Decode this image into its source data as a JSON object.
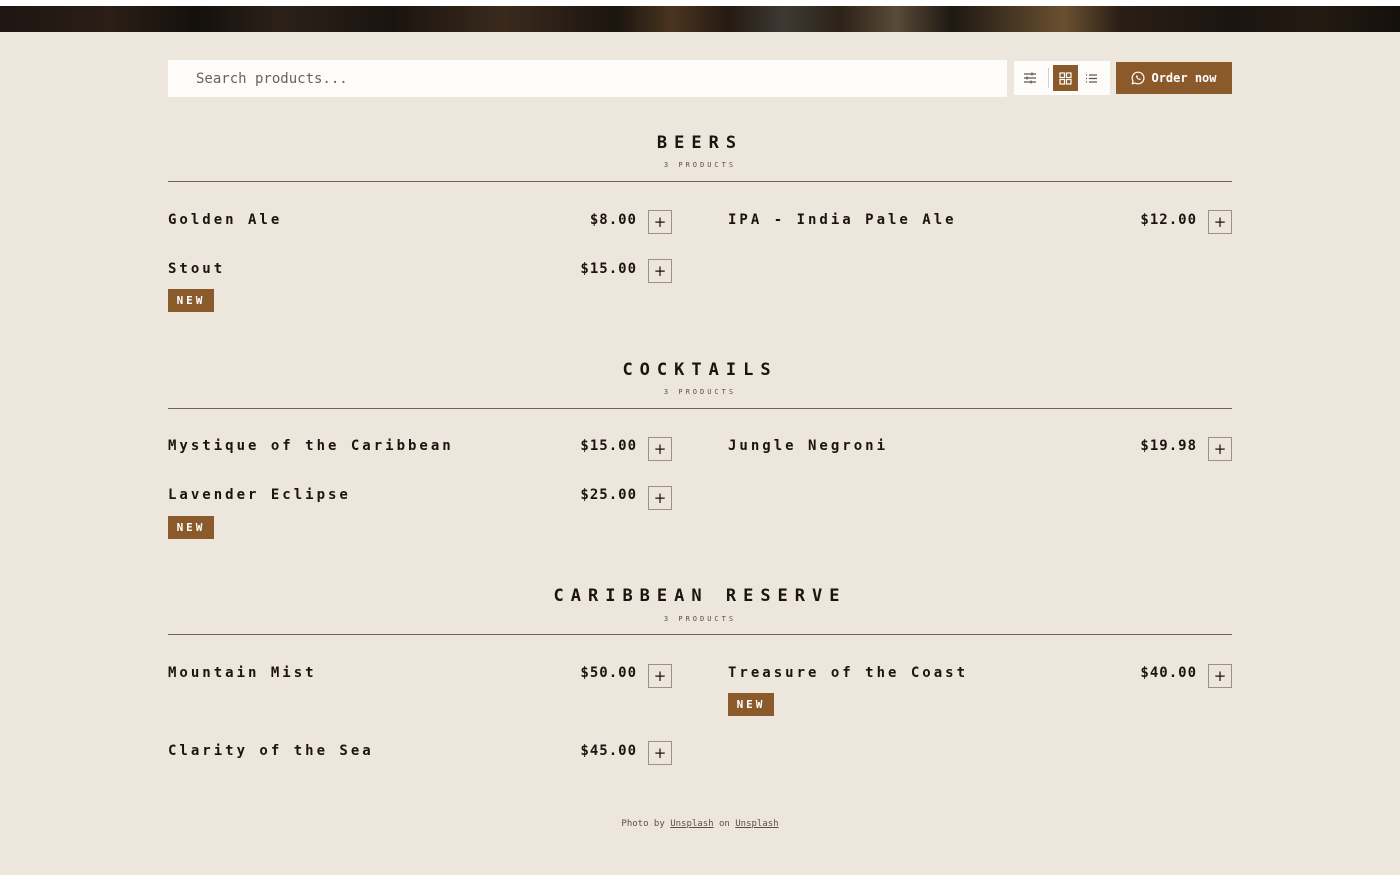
{
  "search": {
    "placeholder": "Search products..."
  },
  "toolbar": {
    "icons": [
      "sliders-icon",
      "grid-icon",
      "list-icon"
    ],
    "order_label": "Order now",
    "accent": "#8b5a2b"
  },
  "sections": [
    {
      "title": "BEERS",
      "count": "3 PRODUCTS",
      "items": [
        {
          "name": "Golden Ale",
          "price": "$8.00"
        },
        {
          "name": "IPA - India Pale Ale",
          "price": "$12.00"
        },
        {
          "name": "Stout",
          "price": "$15.00",
          "badge": "NEW"
        }
      ]
    },
    {
      "title": "COCKTAILS",
      "count": "3 PRODUCTS",
      "items": [
        {
          "name": "Mystique of the Caribbean",
          "price": "$15.00"
        },
        {
          "name": "Jungle Negroni",
          "price": "$19.98"
        },
        {
          "name": "Lavender Eclipse",
          "price": "$25.00",
          "badge": "NEW"
        }
      ]
    },
    {
      "title": "CARIBBEAN RESERVE",
      "count": "3 PRODUCTS",
      "items": [
        {
          "name": "Mountain Mist",
          "price": "$50.00"
        },
        {
          "name": "Treasure of the Coast",
          "price": "$40.00",
          "badge": "NEW"
        },
        {
          "name": "Clarity of the Sea",
          "price": "$45.00"
        }
      ]
    }
  ],
  "add_label": "+",
  "footer": {
    "prefix": "Photo by",
    "author": "Unsplash",
    "middle": "on",
    "site": "Unsplash"
  }
}
